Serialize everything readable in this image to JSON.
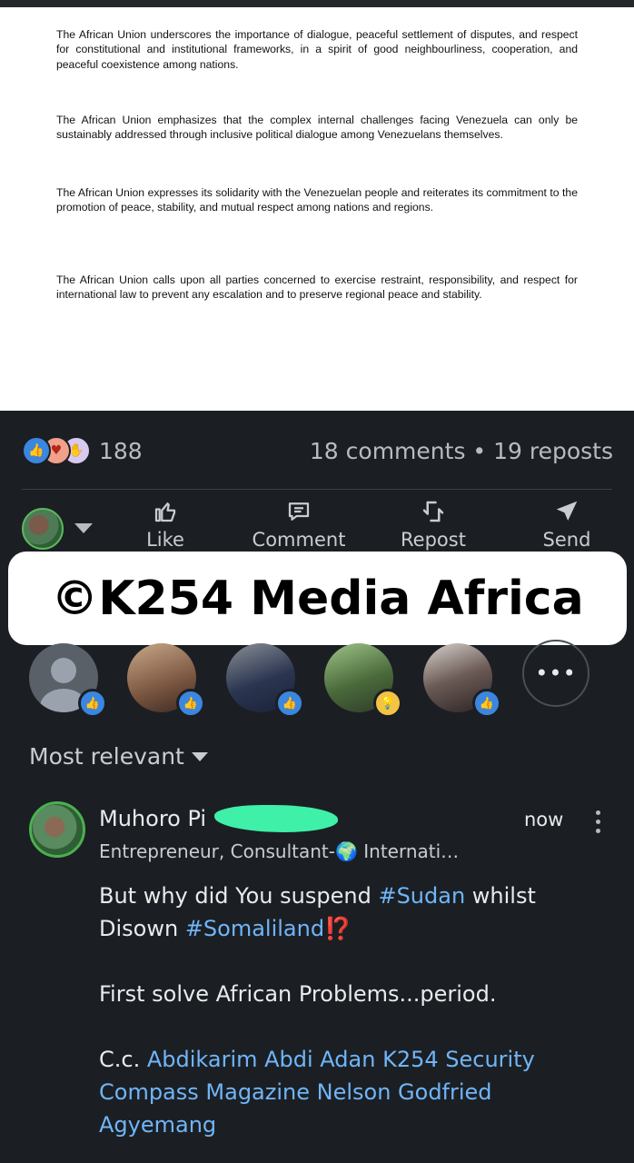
{
  "document": {
    "paragraphs": [
      "The African Union underscores the importance of dialogue, peaceful settlement of disputes, and respect for constitutional and institutional frameworks, in a spirit of good neighbourliness, cooperation, and peaceful coexistence among nations.",
      "The African Union emphasizes that the complex internal challenges facing Venezuela can only be sustainably addressed through inclusive political dialogue among Venezuelans themselves.",
      "The African Union expresses its solidarity with the Venezuelan people and reiterates its commitment to the promotion of peace, stability, and mutual respect among nations and regions.",
      "The African Union calls upon all parties concerned to exercise restraint, responsibility, and respect for international law to prevent any escalation and to preserve regional peace and stability."
    ]
  },
  "social": {
    "reaction_count": "188",
    "stats": "18 comments • 19 reposts",
    "actions": [
      {
        "label": "Like",
        "icon": "thumbs-up-icon"
      },
      {
        "label": "Comment",
        "icon": "comment-icon"
      },
      {
        "label": "Repost",
        "icon": "repost-icon"
      },
      {
        "label": "Send",
        "icon": "send-icon"
      }
    ],
    "reactor_badges": [
      "like",
      "like",
      "like",
      "like",
      "insightful",
      "like"
    ],
    "more_label": "•••"
  },
  "watermark": "©K254 Media Africa",
  "comments": {
    "sort_label": "Most relevant",
    "first": {
      "author_visible": "Muhoro Pi",
      "time": "now",
      "headline": "Entrepreneur, Consultant-🌍 Internati…",
      "line1_pre": "But why did You suspend ",
      "tag_sudan": "#Sudan",
      "line1_post": " whilst",
      "line2_pre": "Disown ",
      "tag_somaliland": "#Somaliland",
      "line2_emoji": "⁉️",
      "line3": "First solve  African Problems...period.",
      "cc_prefix": "C.c. ",
      "mentions_line1": "Abdikarim Abdi Adan K254 Security",
      "mentions_line2": "Compass Magazine Nelson Godfried",
      "mentions_line3": "Agyemang"
    }
  },
  "colors": {
    "background": "#1b1f23",
    "link": "#70b5f9",
    "like_blue": "#3a86e0",
    "redaction": "#3ff0a8"
  }
}
